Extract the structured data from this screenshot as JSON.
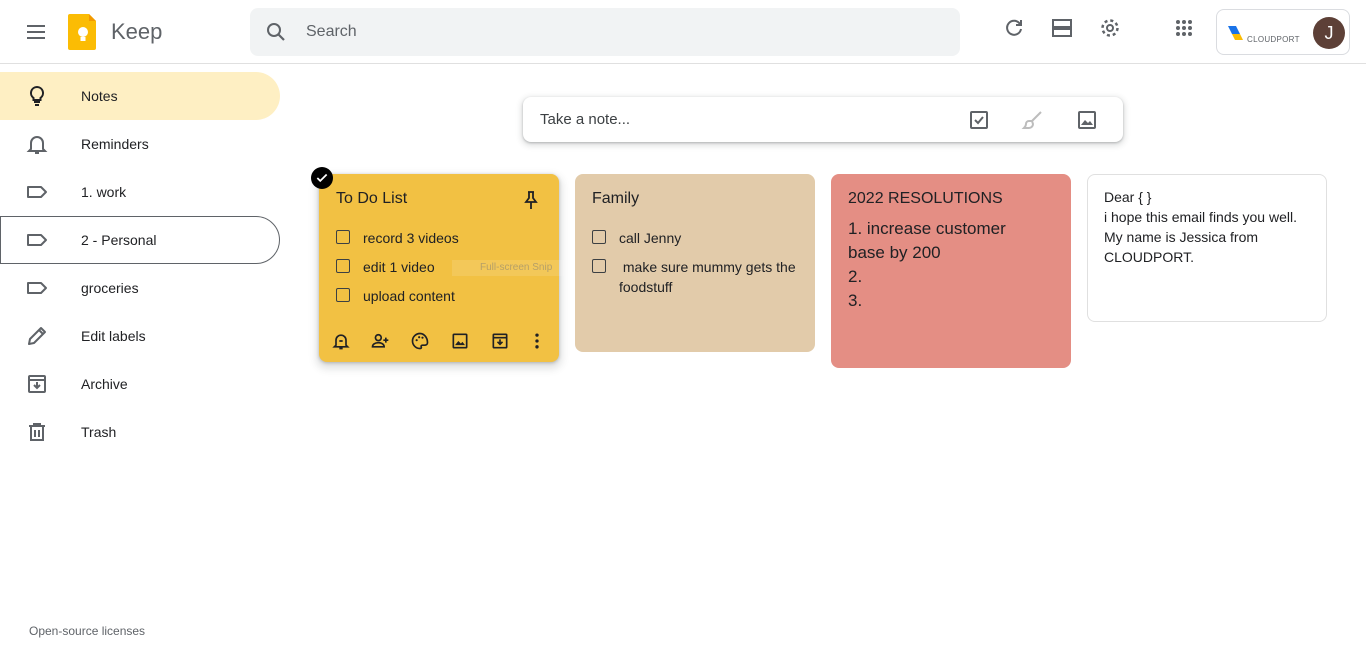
{
  "header": {
    "app_name": "Keep",
    "search_placeholder": "Search",
    "org_name": "CLOUDPORT",
    "avatar_initial": "J",
    "icons": [
      "menu-icon",
      "keep-logo-icon",
      "search-icon",
      "refresh-icon",
      "list-view-icon",
      "settings-icon",
      "apps-grid-icon"
    ]
  },
  "sidebar": {
    "items": [
      {
        "label": "Notes",
        "icon": "lightbulb-icon",
        "active": true
      },
      {
        "label": "Reminders",
        "icon": "bell-icon"
      },
      {
        "label": "1. work",
        "icon": "label-icon"
      },
      {
        "label": "2 - Personal",
        "icon": "label-icon",
        "outlined": true
      },
      {
        "label": "groceries",
        "icon": "label-icon"
      },
      {
        "label": "Edit labels",
        "icon": "pencil-icon"
      },
      {
        "label": "Archive",
        "icon": "archive-icon"
      },
      {
        "label": "Trash",
        "icon": "trash-icon"
      }
    ],
    "footer": "Open-source licenses"
  },
  "take_note": {
    "placeholder": "Take a note...",
    "icons": [
      "checkbox-icon",
      "brush-icon",
      "image-icon"
    ]
  },
  "notes": [
    {
      "title": "To Do List",
      "color": "#f2c143",
      "selected": true,
      "pinned_icon": "pin-icon",
      "items": [
        "record 3 videos",
        "edit 1 video",
        "upload content"
      ],
      "toolbar": [
        "reminder-icon",
        "collaborator-icon",
        "palette-icon",
        "image-icon",
        "archive-icon",
        "more-icon"
      ]
    },
    {
      "title": "Family",
      "color": "#e2cbaa",
      "items": [
        "call Jenny",
        " make sure mummy gets the foodstuff"
      ]
    },
    {
      "title": "2022 RESOLUTIONS",
      "color": "#e48e84",
      "lines": [
        "1. increase customer",
        "base by 200",
        "2.",
        "3."
      ]
    },
    {
      "title": "",
      "color": "#ffffff",
      "body": "Dear { }\ni hope this email finds you well. My name is Jessica from CLOUDPORT."
    }
  ],
  "overlay": {
    "snip_text": "Full-screen Snip"
  },
  "colors": {
    "accent_active": "#feefc3",
    "avatar": "#5d4037"
  }
}
